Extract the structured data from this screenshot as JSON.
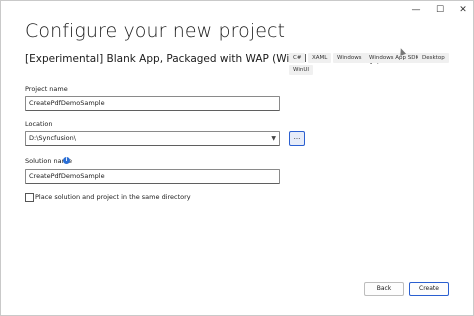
{
  "window": {
    "minimize_glyph": "—",
    "maximize_glyph": "☐",
    "close_glyph": "✕"
  },
  "page": {
    "title": "Configure your new project",
    "template_name": "[Experimental] Blank App, Packaged with WAP (WinUI 3 in Desktop)",
    "tags": [
      "C#",
      "XAML",
      "Windows",
      "Windows App SDK",
      "Desktop",
      "WinUI"
    ]
  },
  "form": {
    "project_name_label": "Project name",
    "project_name_value": "CreatePdfDemoSample",
    "location_label": "Location",
    "location_value": "D:\\Syncfusion\\",
    "browse_label": "...",
    "solution_name_label": "Solution name",
    "solution_name_value": "CreatePdfDemoSample",
    "same_directory_label": "Place solution and project in the same directory",
    "same_directory_checked": false
  },
  "footer": {
    "back_label": "Back",
    "create_label": "Create"
  },
  "colors": {
    "accent": "#2a5fd0",
    "info_icon": "#2b6fd6",
    "tag_bg": "#f0f0f0"
  }
}
